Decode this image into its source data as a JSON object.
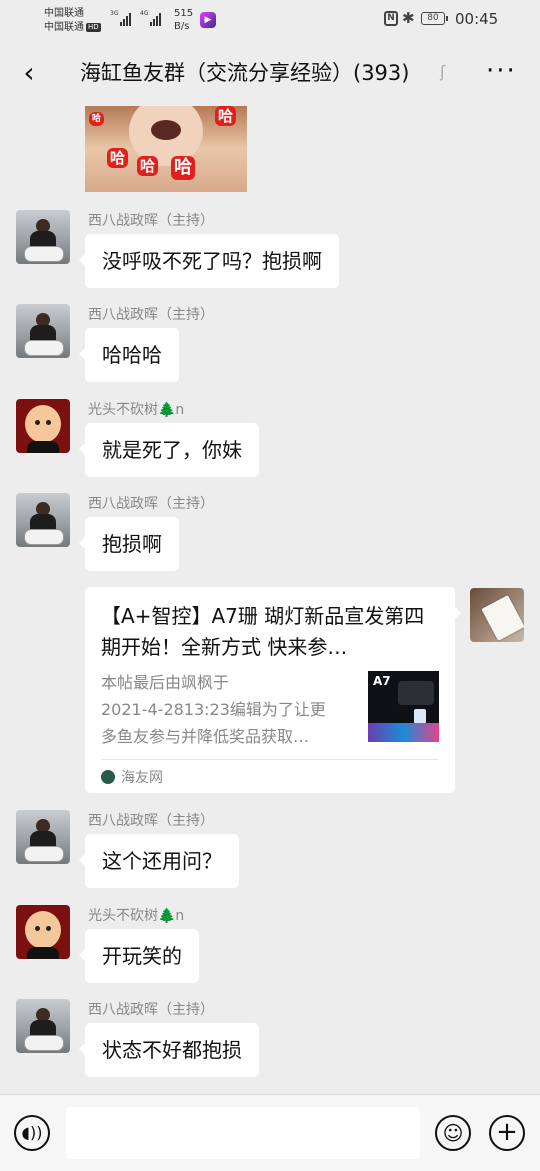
{
  "status_bar": {
    "carrier1": "中国联通",
    "carrier2": "中国联通",
    "hd_badge": "HD",
    "network1": "3G",
    "network2": "4G",
    "speed_value": "515",
    "speed_unit": "B/s",
    "battery": "80",
    "time": "00:45"
  },
  "header": {
    "title": "海缸鱼友群（交流分享经验）(393)",
    "back_icon": "chevron-left",
    "ear_icon": "ear",
    "more_icon": "more-horizontal"
  },
  "sticker": {
    "labels": [
      "哈",
      "哈",
      "哈",
      "哈",
      "哈"
    ]
  },
  "messages": [
    {
      "sender": "西八战政晖（主持）",
      "text": "没呼吸不死了吗？抱损啊"
    },
    {
      "sender": "西八战政晖（主持）",
      "text": "哈哈哈"
    },
    {
      "sender": "光头不砍树🌲n",
      "text": "就是死了，你妹"
    },
    {
      "sender": "西八战政晖（主持）",
      "text": "抱损啊"
    },
    {
      "sender": "西八战政晖（主持）",
      "text": "这个还用问？"
    },
    {
      "sender": "光头不砍树🌲n",
      "text": "开玩笑的"
    },
    {
      "sender": "西八战政晖（主持）",
      "text": "状态不好都抱损"
    }
  ],
  "link_card": {
    "title": "【A+智控】A7珊 瑚灯新品宣发第四期开始！全新方式 快来参…",
    "desc_line1": "本帖最后由飒枫于",
    "desc_line2": "2021-4-2813:23编辑为了让更",
    "desc_line3": "多鱼友参与并降低奖品获取…",
    "thumb_label": "A7",
    "source": "海友网"
  },
  "input_bar": {
    "voice_icon": "voice",
    "emoji_icon": "emoji",
    "plus_icon": "plus"
  }
}
